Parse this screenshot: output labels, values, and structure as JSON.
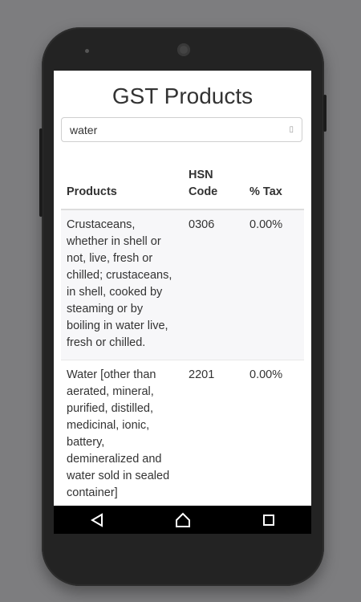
{
  "app": {
    "title": "GST Products"
  },
  "search": {
    "value": "water",
    "icon": "search-icon"
  },
  "table": {
    "headers": {
      "product": "Products",
      "hsn": "HSN Code",
      "tax": "% Tax"
    },
    "rows": [
      {
        "product": "Crustaceans, whether in shell or not, live, fresh or chilled; crustaceans, in shell, cooked by steaming or by boiling in water live, fresh or chilled.",
        "hsn": "0306",
        "tax": "0.00%"
      },
      {
        "product": "Water [other than aerated, mineral, purified, distilled, medicinal, ionic, battery, demineralized and water sold in sealed container]",
        "hsn": "2201",
        "tax": "0.00%"
      }
    ]
  },
  "navbar": {
    "buttons": [
      "back-icon",
      "home-icon",
      "recents-icon"
    ]
  }
}
